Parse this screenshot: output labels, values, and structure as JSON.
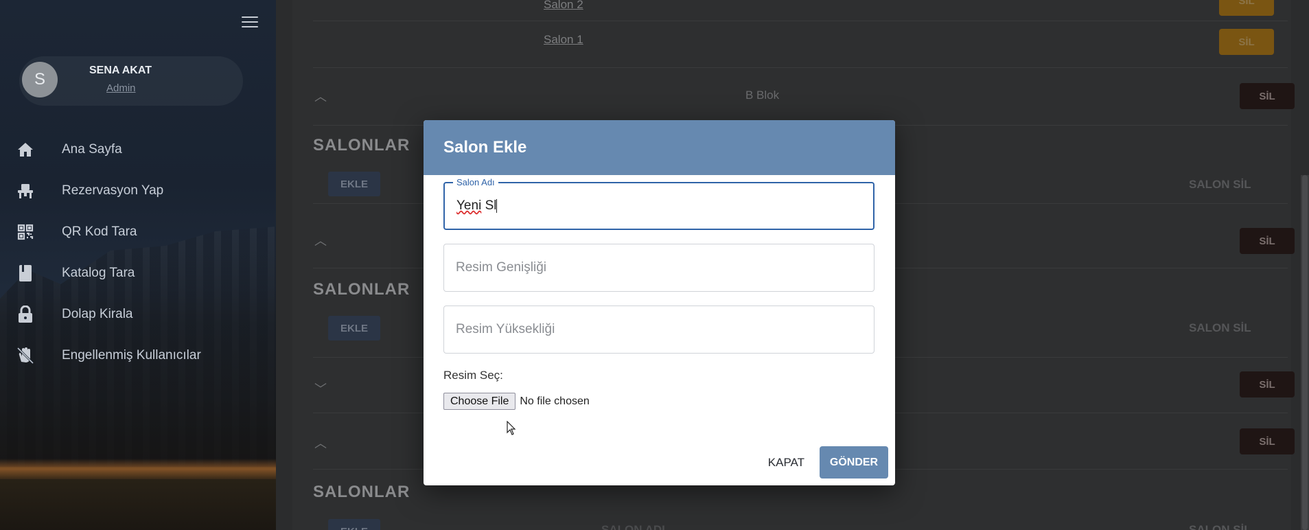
{
  "sidebar": {
    "user": {
      "initial": "S",
      "name": "SENA AKAT",
      "role": "Admin"
    },
    "items": [
      {
        "label": "Ana Sayfa",
        "icon": "home-icon"
      },
      {
        "label": "Rezervasyon Yap",
        "icon": "chair-icon"
      },
      {
        "label": "QR Kod Tara",
        "icon": "qr-code-icon"
      },
      {
        "label": "Katalog Tara",
        "icon": "book-icon"
      },
      {
        "label": "Dolap Kirala",
        "icon": "lock-icon"
      },
      {
        "label": "Engellenmiş Kullanıcılar",
        "icon": "block-hand-icon"
      }
    ]
  },
  "background": {
    "salon_links": [
      "Salon 2",
      "Salon 1"
    ],
    "sil_label": "SİL",
    "blok_name": "B Blok",
    "section_title": "SALONLAR",
    "ekle_label": "EKLE",
    "salon_sil_header": "SALON SİL",
    "salon_adi_header": "SALON ADI"
  },
  "modal": {
    "title": "Salon Ekle",
    "name_field": {
      "label": "Salon Adı",
      "value_underlined": "Yeni",
      "value_rest": " Sl"
    },
    "width_field": {
      "placeholder": "Resim Genişliği"
    },
    "height_field": {
      "placeholder": "Resim Yüksekliği"
    },
    "file_label": "Resim Seç:",
    "file_button": "Choose File",
    "file_status": "No file chosen",
    "close_label": "KAPAT",
    "submit_label": "GÖNDER"
  },
  "colors": {
    "accent": "#6689b0",
    "focus": "#2f63a8",
    "warning_button": "#e8a317",
    "danger_button": "#3b2a28"
  }
}
